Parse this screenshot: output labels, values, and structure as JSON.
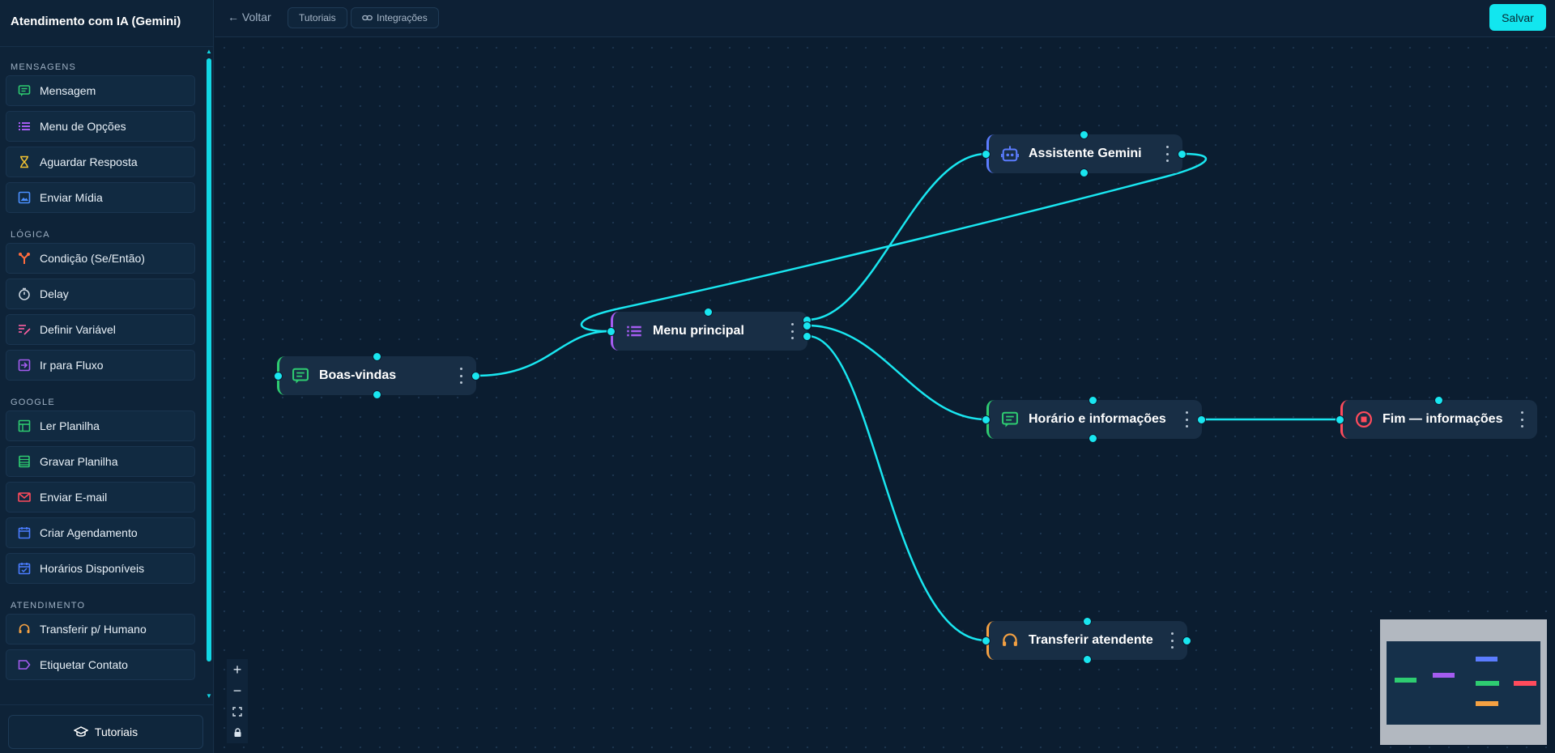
{
  "sidebar": {
    "title": "Atendimento com IA (Gemini)",
    "sections": [
      {
        "label": "MENSAGENS",
        "items": [
          {
            "label": "Mensagem",
            "icon": "chat-icon",
            "color": "#2ecc71"
          },
          {
            "label": "Menu de Opções",
            "icon": "list-icon",
            "color": "#a45cf0"
          },
          {
            "label": "Aguardar Resposta",
            "icon": "hourglass-icon",
            "color": "#f1c232"
          },
          {
            "label": "Enviar Mídia",
            "icon": "image-icon",
            "color": "#4a90ff"
          }
        ]
      },
      {
        "label": "LÓGICA",
        "items": [
          {
            "label": "Condição (Se/Então)",
            "icon": "branch-icon",
            "color": "#ff6b3d"
          },
          {
            "label": "Delay",
            "icon": "stopwatch-icon",
            "color": "#c9d3dd"
          },
          {
            "label": "Definir Variável",
            "icon": "edit-lines-icon",
            "color": "#ff5fa2"
          },
          {
            "label": "Ir para Fluxo",
            "icon": "goto-icon",
            "color": "#a45cf0"
          }
        ]
      },
      {
        "label": "GOOGLE",
        "items": [
          {
            "label": "Ler Planilha",
            "icon": "table-icon",
            "color": "#2ecc71"
          },
          {
            "label": "Gravar Planilha",
            "icon": "sheet-icon",
            "color": "#2ecc71"
          },
          {
            "label": "Enviar E-mail",
            "icon": "mail-icon",
            "color": "#ff4b5c"
          },
          {
            "label": "Criar Agendamento",
            "icon": "calendar-icon",
            "color": "#4a7dff"
          },
          {
            "label": "Horários Disponíveis",
            "icon": "calendar-check-icon",
            "color": "#4a7dff"
          }
        ]
      },
      {
        "label": "ATENDIMENTO",
        "items": [
          {
            "label": "Transferir p/ Humano",
            "icon": "headset-icon",
            "color": "#f5a142"
          },
          {
            "label": "Etiquetar Contato",
            "icon": "tag-icon",
            "color": "#a45cf0"
          }
        ]
      }
    ],
    "footer_button": "Tutoriais"
  },
  "topbar": {
    "back": "← Voltar",
    "tutorials": "Tutoriais",
    "integrations": "Integrações",
    "save": "Salvar"
  },
  "nodes": {
    "boas_vindas": {
      "label": "Boas-vindas",
      "color": "#2ecc71",
      "icon": "chat-icon"
    },
    "menu_principal": {
      "label": "Menu principal",
      "color": "#a45cf0",
      "icon": "list-icon"
    },
    "assistente_gemini": {
      "label": "Assistente Gemini",
      "color": "#5b7cff",
      "icon": "robot-icon"
    },
    "horario": {
      "label": "Horário e informações",
      "color": "#2ecc71",
      "icon": "chat-icon"
    },
    "fim": {
      "label": "Fim — informações",
      "color": "#ff4b5c",
      "icon": "stop-icon"
    },
    "transferir": {
      "label": "Transferir atendente",
      "color": "#f5a142",
      "icon": "headset-icon"
    }
  },
  "accent": "#19e6f0"
}
